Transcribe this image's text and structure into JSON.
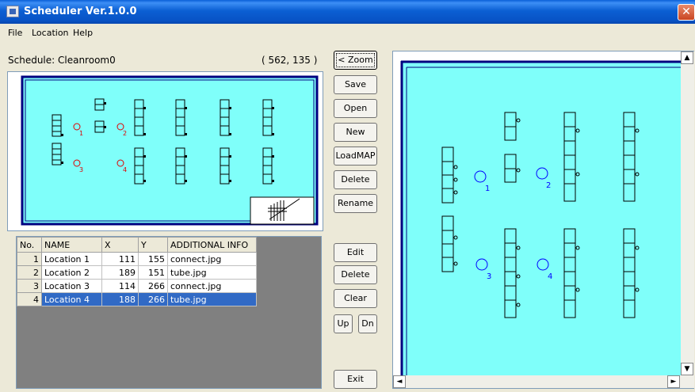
{
  "window": {
    "title": "Scheduler Ver.1.0.0",
    "close_glyph": "✕"
  },
  "menu": [
    "File",
    "Location",
    "Help"
  ],
  "schedule": {
    "label": "Schedule: Cleanroom0",
    "coords": "( 562, 135 )"
  },
  "buttons": {
    "zoom": "< Zoom",
    "save": "Save",
    "open": "Open",
    "new": "New",
    "loadmap": "LoadMAP",
    "delete_schedule": "Delete",
    "rename": "Rename",
    "edit": "Edit",
    "delete_location": "Delete",
    "clear": "Clear",
    "up": "Up",
    "down": "Dn",
    "exit": "Exit"
  },
  "table": {
    "headers": [
      "No.",
      "NAME",
      "X",
      "Y",
      "ADDITIONAL INFO"
    ],
    "rows": [
      [
        "1",
        "Location 1",
        "111",
        "155",
        "connect.jpg"
      ],
      [
        "2",
        "Location 2",
        "189",
        "151",
        "tube.jpg"
      ],
      [
        "3",
        "Location 3",
        "114",
        "266",
        "connect.jpg"
      ],
      [
        "4",
        "Location 4",
        "188",
        "266",
        "tube.jpg"
      ]
    ],
    "selected_row": 3
  },
  "map": {
    "location_markers": [
      "1",
      "2",
      "3",
      "4"
    ],
    "colors": {
      "floor": "#7ffffa",
      "wall": "#000080",
      "marker_minimap": "#e00000",
      "marker_bigmap": "#0000ff",
      "selection": "#316ac5"
    }
  },
  "scroll": {
    "up": "▲",
    "down": "▼",
    "left": "◄",
    "right": "►"
  }
}
